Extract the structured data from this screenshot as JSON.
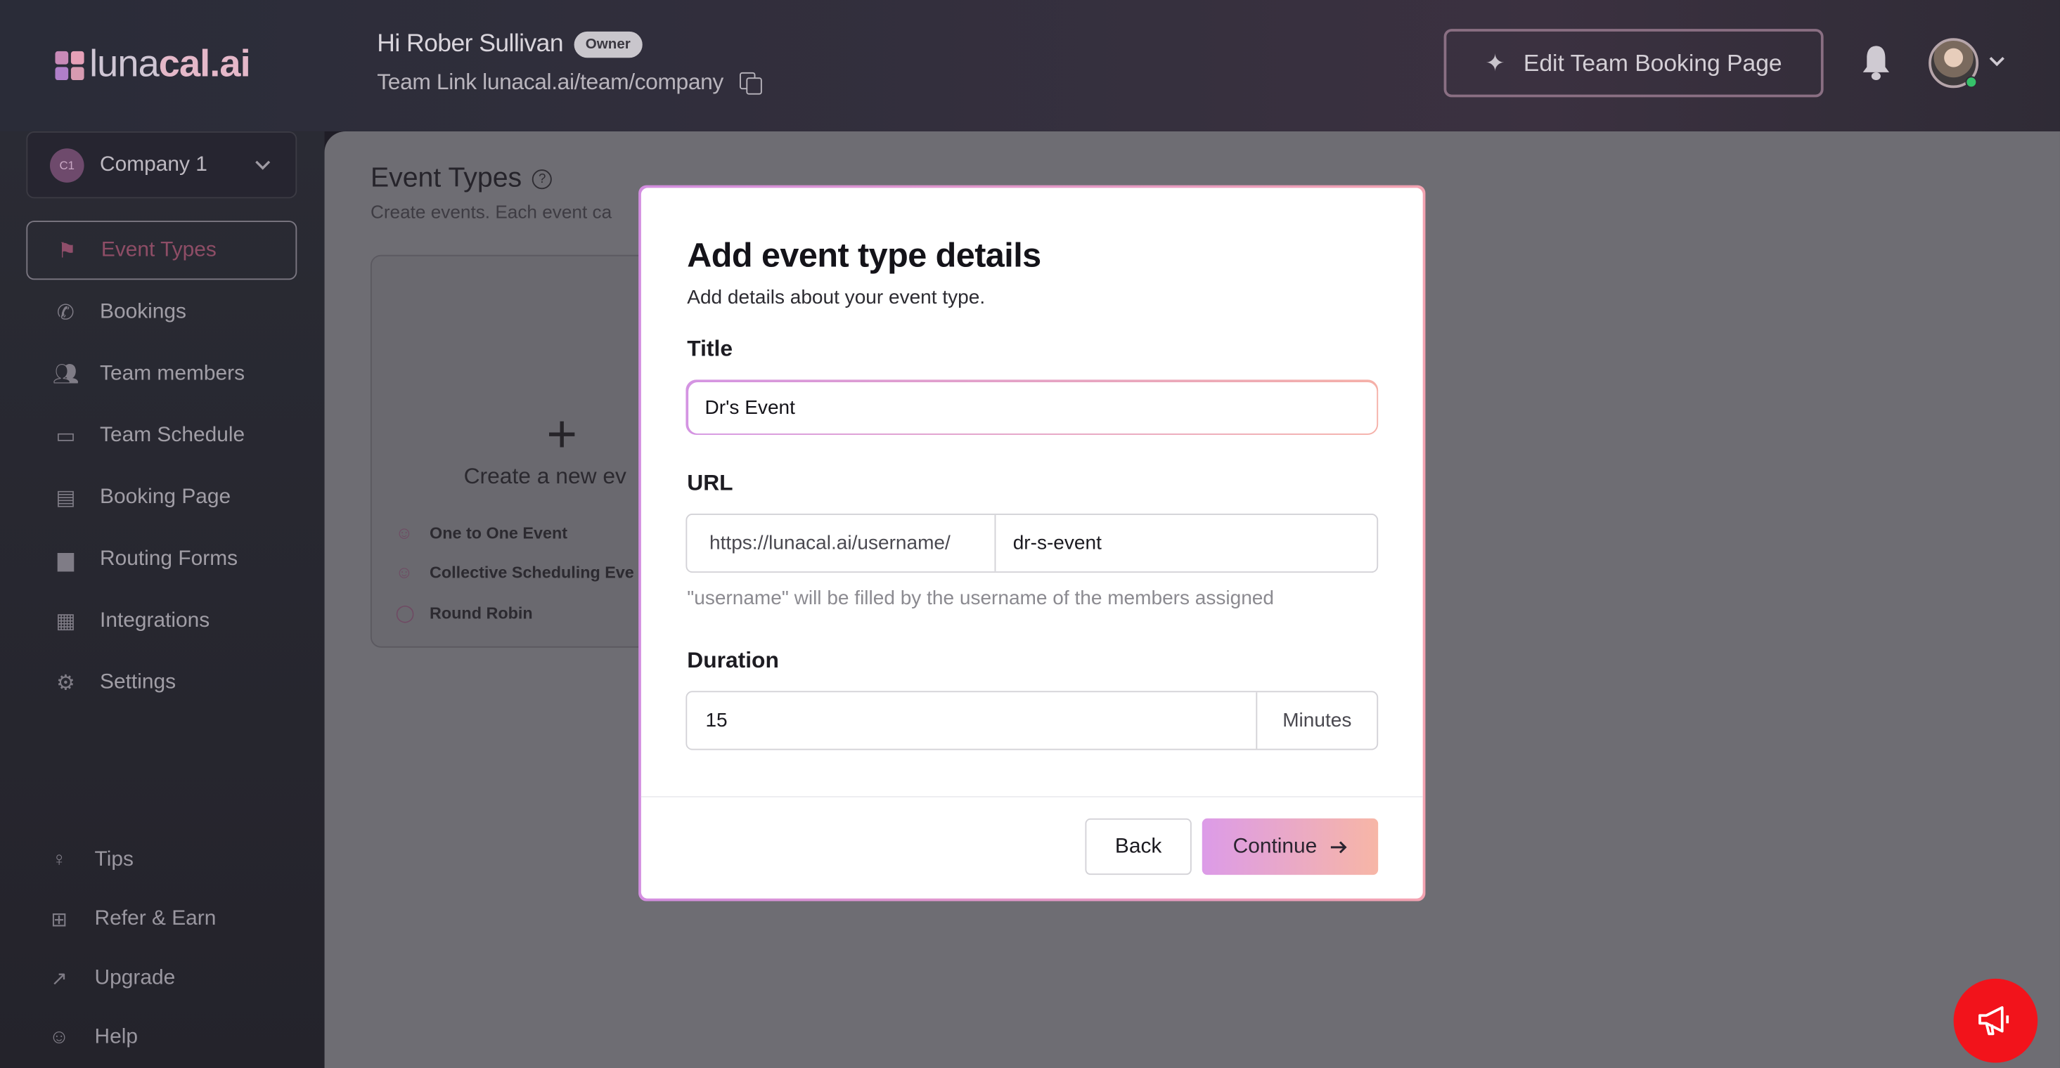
{
  "brand": {
    "logo_light": "luna",
    "logo_bold": "cal.ai"
  },
  "header": {
    "greeting": "Hi Rober Sullivan",
    "role_badge": "Owner",
    "team_link": "Team Link lunacal.ai/team/company",
    "edit_button": "Edit Team Booking Page"
  },
  "sidebar": {
    "company": {
      "initials": "C1",
      "name": "Company 1"
    },
    "items": [
      {
        "label": "Event Types",
        "icon": "flag-icon",
        "active": true
      },
      {
        "label": "Bookings",
        "icon": "phone-icon"
      },
      {
        "label": "Team members",
        "icon": "users-icon"
      },
      {
        "label": "Team Schedule",
        "icon": "calendar-icon"
      },
      {
        "label": "Booking Page",
        "icon": "layout-icon"
      },
      {
        "label": "Routing Forms",
        "icon": "file-icon"
      },
      {
        "label": "Integrations",
        "icon": "grid-icon"
      },
      {
        "label": "Settings",
        "icon": "gear-icon"
      }
    ],
    "bottom": [
      {
        "label": "Tips",
        "icon": "lightbulb-icon"
      },
      {
        "label": "Refer & Earn",
        "icon": "gift-icon"
      },
      {
        "label": "Upgrade",
        "icon": "trend-icon"
      },
      {
        "label": "Help",
        "icon": "user-help-icon"
      }
    ]
  },
  "main": {
    "title": "Event Types",
    "subtitle": "Create events. Each event ca",
    "create_card": {
      "label": "Create a new ev",
      "options": [
        "One to One Event",
        "Collective Scheduling Eve",
        "Round Robin"
      ]
    }
  },
  "modal": {
    "title": "Add event type details",
    "subtitle": "Add details about your event type.",
    "title_label": "Title",
    "title_value": "Dr's Event",
    "url_label": "URL",
    "url_prefix": "https://lunacal.ai/username/",
    "url_slug": "dr-s-event",
    "url_hint": "\"username\" will be filled by the username of the members assigned",
    "duration_label": "Duration",
    "duration_value": "15",
    "duration_unit": "Minutes",
    "back_label": "Back",
    "continue_label": "Continue"
  },
  "colors": {
    "accent_start": "#dc9be8",
    "accent_end": "#f7b6a6",
    "fab": "#f2131b"
  }
}
